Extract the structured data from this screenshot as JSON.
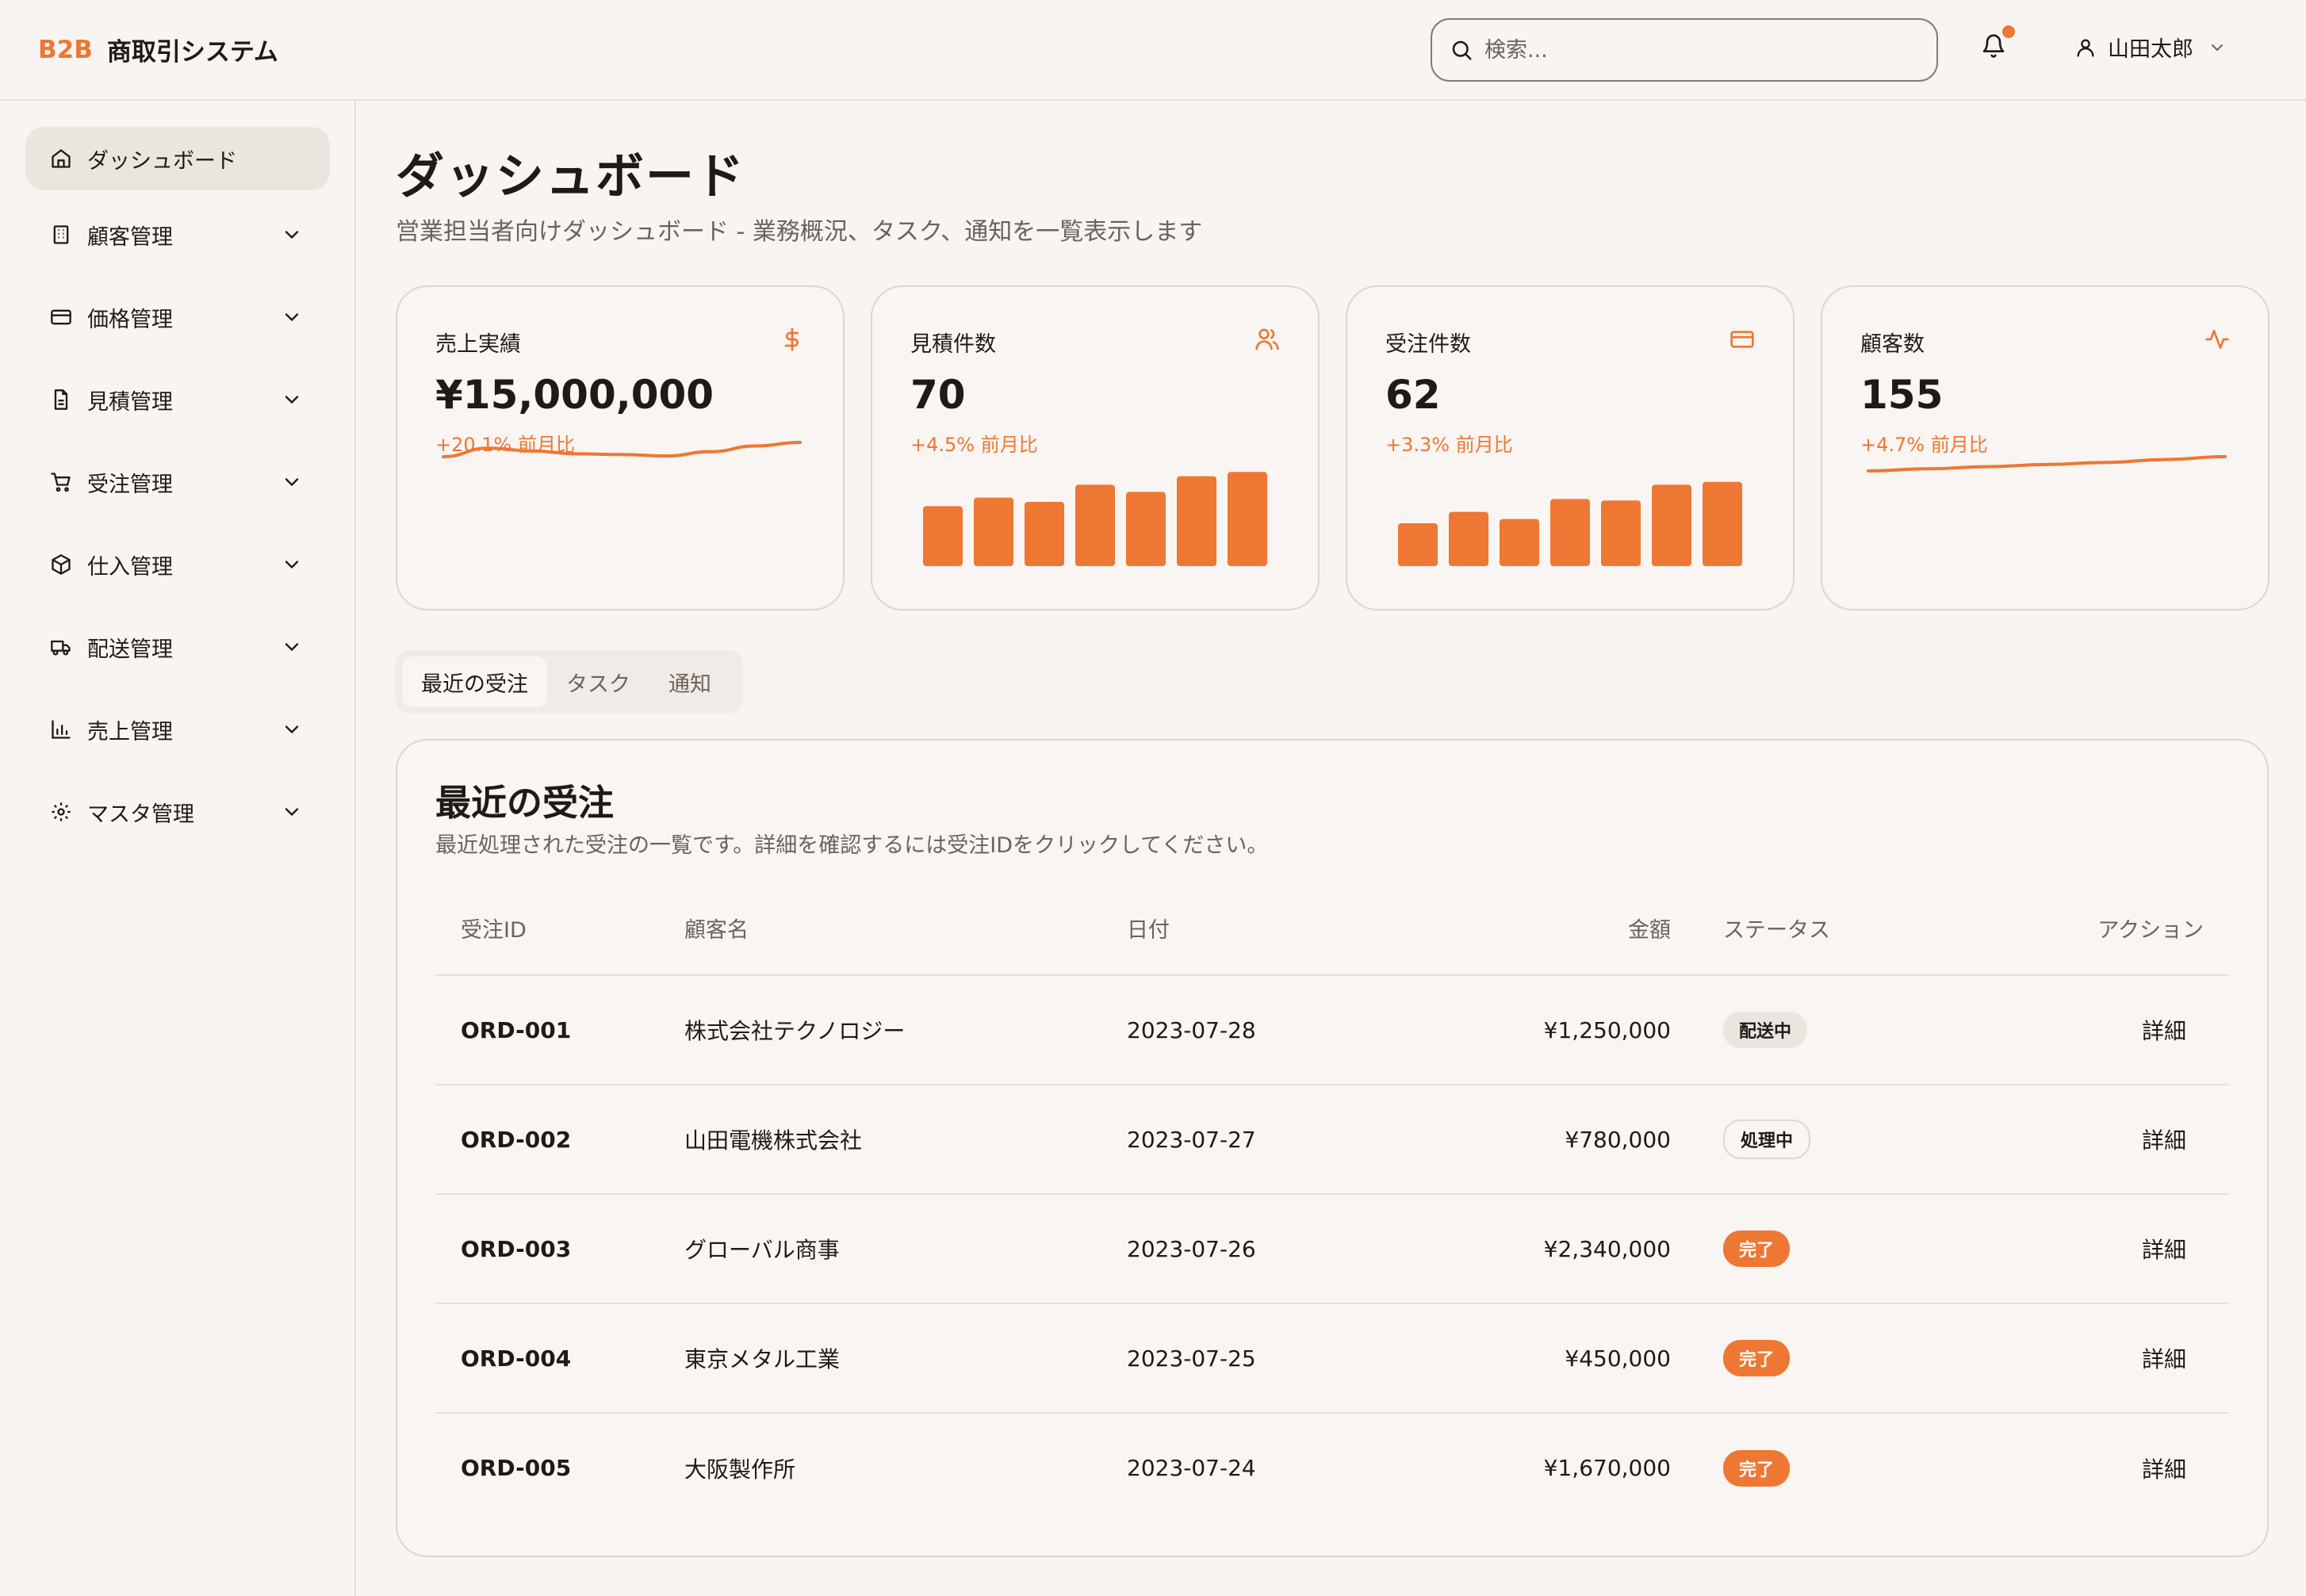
{
  "header": {
    "brand_prefix": "B2B",
    "brand_name": "商取引システム",
    "search_placeholder": "検索...",
    "user_name": "山田太郎"
  },
  "sidebar": {
    "items": [
      {
        "label": "ダッシュボード",
        "icon": "home-icon"
      },
      {
        "label": "顧客管理",
        "icon": "building-icon"
      },
      {
        "label": "価格管理",
        "icon": "credit-card-icon"
      },
      {
        "label": "見積管理",
        "icon": "document-icon"
      },
      {
        "label": "受注管理",
        "icon": "cart-icon"
      },
      {
        "label": "仕入管理",
        "icon": "package-icon"
      },
      {
        "label": "配送管理",
        "icon": "truck-icon"
      },
      {
        "label": "売上管理",
        "icon": "bar-chart-icon"
      },
      {
        "label": "マスタ管理",
        "icon": "gear-icon"
      }
    ]
  },
  "page": {
    "title": "ダッシュボード",
    "subtitle": "営業担当者向けダッシュボード - 業務概況、タスク、通知を一覧表示します"
  },
  "kpis": [
    {
      "label": "売上実績",
      "value": "¥15,000,000",
      "delta": "+20.1% 前月比",
      "icon": "dollar-icon"
    },
    {
      "label": "見積件数",
      "value": "70",
      "delta": "+4.5% 前月比",
      "icon": "users-icon"
    },
    {
      "label": "受注件数",
      "value": "62",
      "delta": "+3.3% 前月比",
      "icon": "credit-card-icon"
    },
    {
      "label": "顧客数",
      "value": "155",
      "delta": "+4.7% 前月比",
      "icon": "activity-icon"
    }
  ],
  "chart_data": [
    {
      "type": "line",
      "values": [
        40,
        52,
        48,
        44,
        43,
        41,
        47,
        55,
        60
      ]
    },
    {
      "type": "bar",
      "values": [
        42,
        48,
        45,
        57,
        52,
        63,
        66
      ]
    },
    {
      "type": "bar",
      "values": [
        30,
        38,
        33,
        47,
        46,
        57,
        59
      ]
    },
    {
      "type": "line",
      "values": [
        20,
        23,
        26,
        29,
        32,
        36,
        40
      ]
    }
  ],
  "tabs": [
    "最近の受注",
    "タスク",
    "通知"
  ],
  "orders": {
    "title": "最近の受注",
    "description": "最近処理された受注の一覧です。詳細を確認するには受注IDをクリックしてください。",
    "columns": [
      "受注ID",
      "顧客名",
      "日付",
      "金額",
      "ステータス",
      "アクション"
    ],
    "rows": [
      {
        "id": "ORD-001",
        "customer": "株式会社テクノロジー",
        "date": "2023-07-28",
        "amount": "¥1,250,000",
        "status": "配送中",
        "status_type": "shipping",
        "action": "詳細"
      },
      {
        "id": "ORD-002",
        "customer": "山田電機株式会社",
        "date": "2023-07-27",
        "amount": "¥780,000",
        "status": "処理中",
        "status_type": "processing",
        "action": "詳細"
      },
      {
        "id": "ORD-003",
        "customer": "グローバル商事",
        "date": "2023-07-26",
        "amount": "¥2,340,000",
        "status": "完了",
        "status_type": "done",
        "action": "詳細"
      },
      {
        "id": "ORD-004",
        "customer": "東京メタル工業",
        "date": "2023-07-25",
        "amount": "¥450,000",
        "status": "完了",
        "status_type": "done",
        "action": "詳細"
      },
      {
        "id": "ORD-005",
        "customer": "大阪製作所",
        "date": "2023-07-24",
        "amount": "¥1,670,000",
        "status": "完了",
        "status_type": "done",
        "action": "詳細"
      }
    ]
  },
  "colors": {
    "accent": "#ee7733",
    "background": "#f7f4f1",
    "muted_text": "#6b625c"
  }
}
